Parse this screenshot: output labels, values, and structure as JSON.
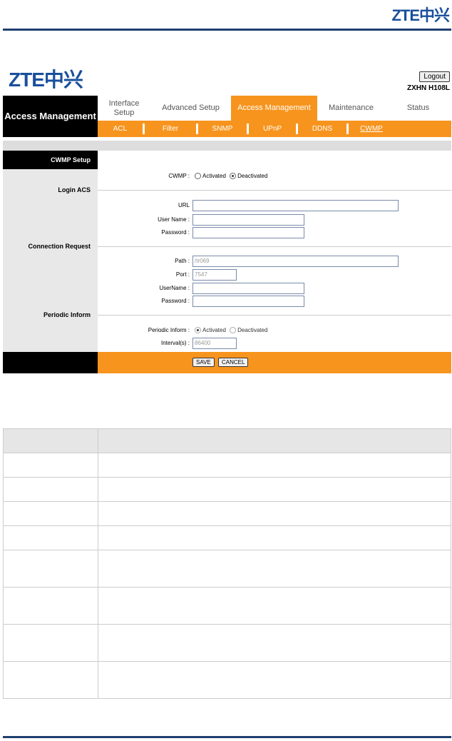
{
  "brand": {
    "logo_top": "ZTE中兴",
    "logo_router": "ZTE中兴"
  },
  "router": {
    "logout_label": "Logout",
    "model": "ZXHN H108L"
  },
  "header": {
    "section_title": "Access Management",
    "tabs": [
      {
        "label": "Interface Setup",
        "active": false
      },
      {
        "label": "Advanced Setup",
        "active": false
      },
      {
        "label": "Access Management",
        "active": true
      },
      {
        "label": "Maintenance",
        "active": false
      },
      {
        "label": "Status",
        "active": false
      }
    ],
    "subtabs": [
      {
        "label": "ACL",
        "active": false
      },
      {
        "label": "Filter",
        "active": false
      },
      {
        "label": "SNMP",
        "active": false
      },
      {
        "label": "UPnP",
        "active": false
      },
      {
        "label": "DDNS",
        "active": false
      },
      {
        "label": "CWMP",
        "active": true
      }
    ]
  },
  "sections": {
    "cwmp_setup": "CWMP Setup",
    "login_acs": "Login ACS",
    "connection_request": "Connection Request",
    "periodic_inform": "Periodic Inform"
  },
  "cwmp": {
    "label": "CWMP :",
    "options": [
      "Activated",
      "Deactivated"
    ],
    "selected": "Deactivated"
  },
  "login_acs": {
    "url_label": "URL",
    "url_value": "",
    "username_label": "User Name :",
    "username_value": "",
    "password_label": "Password :",
    "password_value": ""
  },
  "connection_request": {
    "path_label": "Path :",
    "path_value": "/tr069",
    "port_label": "Port :",
    "port_value": "7547",
    "username_label": "UserName :",
    "username_value": "",
    "password_label": "Password :",
    "password_value": ""
  },
  "periodic_inform": {
    "label": "Periodic Inform :",
    "options": [
      "Activated",
      "Deactivated"
    ],
    "selected": "Activated",
    "interval_label": "Interval(s) :",
    "interval_value": "86400"
  },
  "footer": {
    "save_label": "SAVE",
    "cancel_label": "CANCEL"
  },
  "colors": {
    "brand_blue": "#1a4f9c",
    "accent_orange": "#f7941d",
    "rule_navy": "#1f3f6e"
  }
}
